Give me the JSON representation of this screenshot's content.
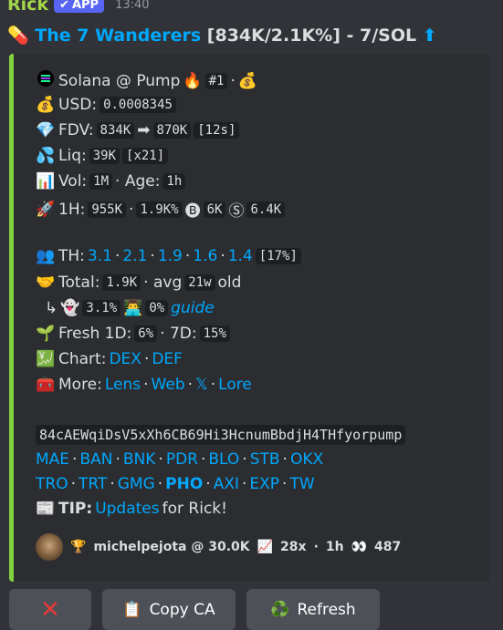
{
  "header": {
    "author": "Rick",
    "badge": "APP",
    "time": "13:40"
  },
  "title": {
    "emoji": "💊",
    "link": "The 7 Wanderers",
    "rest": " [834K/2.1K%] - 7/SOL ",
    "arrow": "⬆"
  },
  "line1": {
    "text": "Solana @ Pump",
    "rank": "#1"
  },
  "usd": {
    "label": "USD:",
    "value": "0.0008345"
  },
  "fdv": {
    "label": "FDV:",
    "from": "834K",
    "arrow": "➡",
    "to": "870K",
    "age": "[12s]"
  },
  "liq": {
    "label": "Liq:",
    "value": "39K",
    "mult": "[x21]"
  },
  "vol": {
    "label": "Vol:",
    "value": "1M",
    "age_label": "· Age:",
    "age": "1h"
  },
  "h1": {
    "label": "1H:",
    "vol": "955K",
    "pct": "1.9K%",
    "b": "6K",
    "s": "6.4K"
  },
  "th": {
    "label": "TH:",
    "values": [
      "3.1",
      "2.1",
      "1.9",
      "1.6",
      "1.4"
    ],
    "pct": "[17%]"
  },
  "total": {
    "label": "Total:",
    "value": "1.9K",
    "avg_label": "· avg",
    "avg": "21w",
    "old": "old"
  },
  "sub": {
    "arrow": "↳",
    "ghost_pct": "3.1%",
    "dev_pct": "0%",
    "guide": "guide"
  },
  "fresh": {
    "label": "Fresh 1D:",
    "d1": "6%",
    "d7_label": "· 7D:",
    "d7": "15%"
  },
  "chart": {
    "label": "Chart:",
    "links": [
      "DEX",
      "DEF"
    ]
  },
  "more": {
    "label": "More:",
    "links": [
      "Lens",
      "Web",
      "𝕏",
      "Lore"
    ]
  },
  "ca": "84cAEWqiDsV5xXh6CB69Hi3HcnumBbdjH4THfyorpump",
  "bots1": [
    "MAE",
    "BAN",
    "BNK",
    "PDR",
    "BLO",
    "STB",
    "OKX"
  ],
  "bots2": [
    "TRO",
    "TRT",
    "GMG",
    "PHO",
    "AXI",
    "EXP",
    "TW"
  ],
  "tip": {
    "label": "TIP:",
    "link": "Updates",
    "rest": "for Rick!"
  },
  "footer": {
    "user": "michelpejota @ 30.0K",
    "mult": "28x",
    "time": "1h",
    "views": "487"
  },
  "buttons": {
    "copy": "Copy CA",
    "refresh": "Refresh"
  }
}
